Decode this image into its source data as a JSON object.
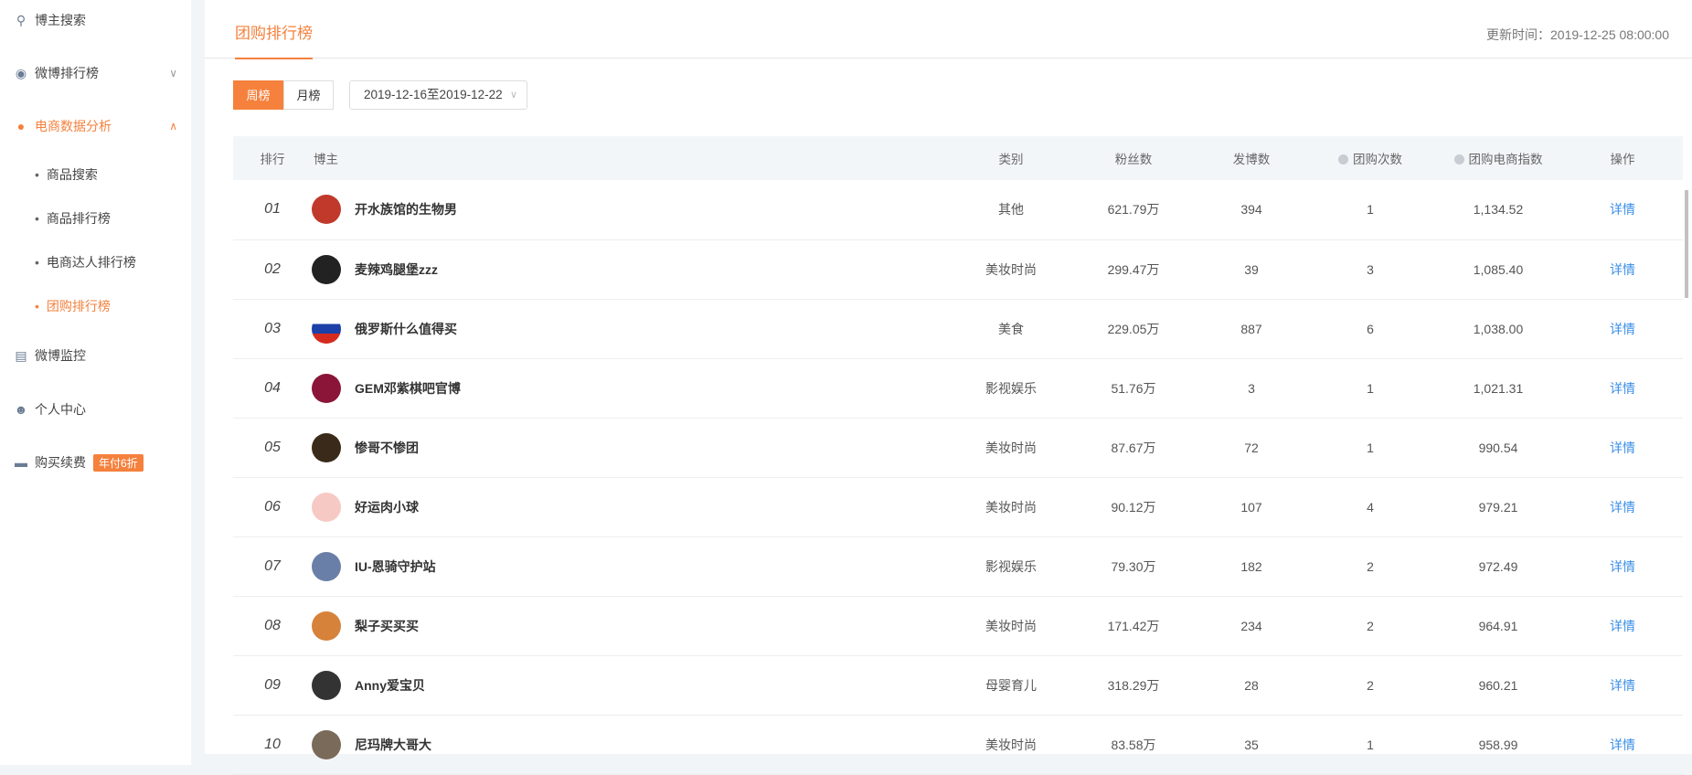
{
  "sidebar": {
    "items": [
      {
        "label": "博主搜索",
        "icon": "search-icon"
      },
      {
        "label": "微博排行榜",
        "icon": "trophy-icon"
      },
      {
        "label": "电商数据分析",
        "icon": "pie-icon"
      },
      {
        "label": "微博监控",
        "icon": "monitor-chart-icon"
      },
      {
        "label": "个人中心",
        "icon": "user-icon"
      },
      {
        "label": "购买续费",
        "icon": "card-icon",
        "badge": "年付6折"
      }
    ],
    "subitems": [
      "商品搜索",
      "商品排行榜",
      "电商达人排行榜",
      "团购排行榜"
    ]
  },
  "header": {
    "tab": "团购排行榜",
    "update_time": "更新时间：2019-12-25 08:00:00"
  },
  "filters": {
    "weekly": "周榜",
    "monthly": "月榜",
    "date_range": "2019-12-16至2019-12-22"
  },
  "colors": {
    "accent": "#f5813d",
    "link": "#3a8ee6"
  },
  "table": {
    "headers": [
      "排行",
      "博主",
      "类别",
      "粉丝数",
      "发博数",
      "团购次数",
      "团购电商指数",
      "操作"
    ],
    "rows": [
      {
        "rank": "01",
        "name": "开水族馆的生物男",
        "cat": "其他",
        "fans": "621.79万",
        "posts": "394",
        "count": "1",
        "index": "1,134.52",
        "op": "详情"
      },
      {
        "rank": "02",
        "name": "麦辣鸡腿堡zzz",
        "cat": "美妆时尚",
        "fans": "299.47万",
        "posts": "39",
        "count": "3",
        "index": "1,085.40",
        "op": "详情"
      },
      {
        "rank": "03",
        "name": "俄罗斯什么值得买",
        "cat": "美食",
        "fans": "229.05万",
        "posts": "887",
        "count": "6",
        "index": "1,038.00",
        "op": "详情"
      },
      {
        "rank": "04",
        "name": "GEM邓紫棋吧官博",
        "cat": "影视娱乐",
        "fans": "51.76万",
        "posts": "3",
        "count": "1",
        "index": "1,021.31",
        "op": "详情"
      },
      {
        "rank": "05",
        "name": "惨哥不惨团",
        "cat": "美妆时尚",
        "fans": "87.67万",
        "posts": "72",
        "count": "1",
        "index": "990.54",
        "op": "详情"
      },
      {
        "rank": "06",
        "name": "好运肉小球",
        "cat": "美妆时尚",
        "fans": "90.12万",
        "posts": "107",
        "count": "4",
        "index": "979.21",
        "op": "详情"
      },
      {
        "rank": "07",
        "name": "IU-恩骑守护站",
        "cat": "影视娱乐",
        "fans": "79.30万",
        "posts": "182",
        "count": "2",
        "index": "972.49",
        "op": "详情"
      },
      {
        "rank": "08",
        "name": "梨子买买买",
        "cat": "美妆时尚",
        "fans": "171.42万",
        "posts": "234",
        "count": "2",
        "index": "964.91",
        "op": "详情"
      },
      {
        "rank": "09",
        "name": "Anny爱宝贝",
        "cat": "母婴育儿",
        "fans": "318.29万",
        "posts": "28",
        "count": "2",
        "index": "960.21",
        "op": "详情"
      },
      {
        "rank": "10",
        "name": "尼玛牌大哥大",
        "cat": "美妆时尚",
        "fans": "83.58万",
        "posts": "35",
        "count": "1",
        "index": "958.99",
        "op": "详情"
      }
    ]
  }
}
